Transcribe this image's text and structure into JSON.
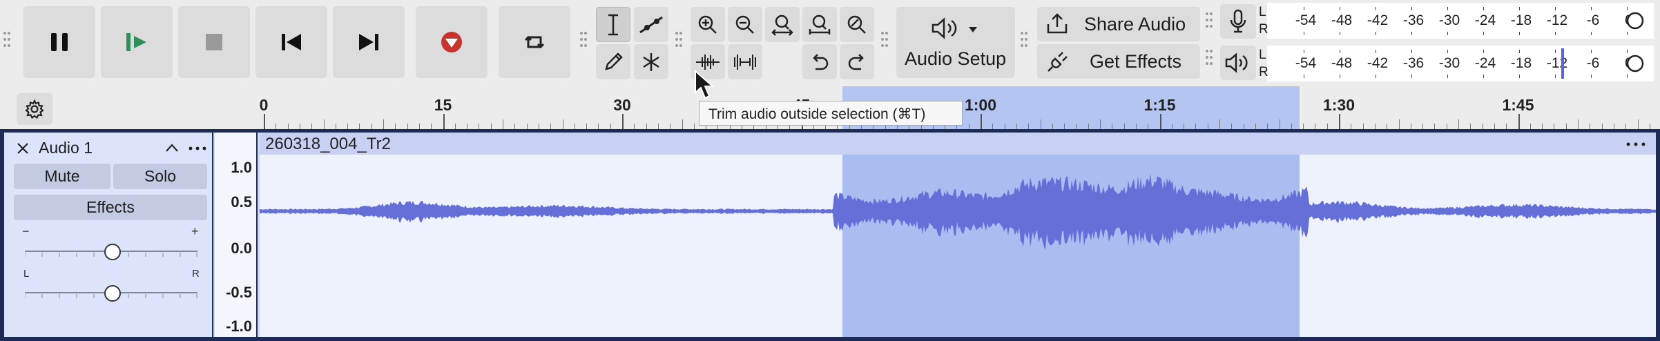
{
  "toolbar": {
    "audio_setup_label": "Audio Setup",
    "share_audio_label": "Share Audio",
    "get_effects_label": "Get Effects",
    "tooltip": "Trim audio outside selection (⌘T)"
  },
  "meters": {
    "record": {
      "channel_left": "L",
      "channel_right": "R"
    },
    "playback": {
      "channel_left": "L",
      "channel_right": "R"
    },
    "scale": [
      "-54",
      "-48",
      "-42",
      "-36",
      "-30",
      "-24",
      "-18",
      "-12",
      "-6",
      "0"
    ]
  },
  "ruler": {
    "labels": [
      "0",
      "15",
      "30",
      "45",
      "1:00",
      "1:15",
      "1:30",
      "1:45"
    ]
  },
  "track": {
    "name": "Audio 1",
    "mute_label": "Mute",
    "solo_label": "Solo",
    "effects_label": "Effects",
    "gain_min": "−",
    "gain_max": "+",
    "pan_left": "L",
    "pan_right": "R",
    "clip_name": "260318_004_Tr2",
    "amplitude_labels": [
      "1.0",
      "0.5",
      "0.0",
      "-0.5",
      "-1.0"
    ]
  },
  "colors": {
    "waveform": "#6470d8",
    "selection": "#a9bdf1",
    "record_red": "#c8332f",
    "play_green": "#2f8f5b"
  }
}
